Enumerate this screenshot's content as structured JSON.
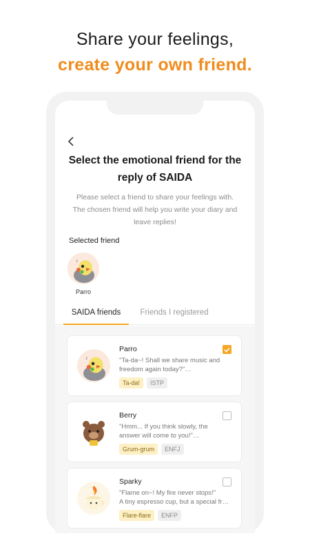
{
  "headline": {
    "line1": "Share your feelings,",
    "line2": "create your own friend."
  },
  "screen": {
    "back_icon": "chevron-left-icon",
    "title_line1": "Select the emotional friend for the",
    "title_line2": "reply of SAIDA",
    "desc_line1": "Please select a friend to share your feelings with.",
    "desc_line2": "The chosen friend will help you write your diary and",
    "desc_line3": "leave replies!",
    "selected_label": "Selected friend",
    "selected_friend": "Parro",
    "tabs": [
      {
        "label": "SAIDA friends",
        "active": true
      },
      {
        "label": "Friends I registered",
        "active": false
      }
    ],
    "friends": [
      {
        "name": "Parro",
        "quote_line1": "\"Ta-da~! Shall we share music and",
        "quote_line2": "freedom again today?\"…",
        "mood": "Ta-da!",
        "mbti": "ISTP",
        "selected": true,
        "avatar_icon": "parrot-avatar-icon"
      },
      {
        "name": "Berry",
        "quote_line1": "\"Hmm... If you think slowly, the",
        "quote_line2": "answer will come to you!\"…",
        "mood": "Grum-grum",
        "mbti": "ENFJ",
        "selected": false,
        "avatar_icon": "bear-avatar-icon"
      },
      {
        "name": "Sparky",
        "quote_line1": "\"Flame on~! My fire never stops!\"",
        "quote_line2": " A tiny espresso cup, but a special fr…",
        "mood": "Flare-flare",
        "mbti": "ENFP",
        "selected": false,
        "avatar_icon": "espresso-flame-avatar-icon"
      }
    ],
    "colors": {
      "accent": "#f6a623",
      "headline_orange": "#f08c1e",
      "mood_tag_bg": "#fdf0c4"
    }
  }
}
